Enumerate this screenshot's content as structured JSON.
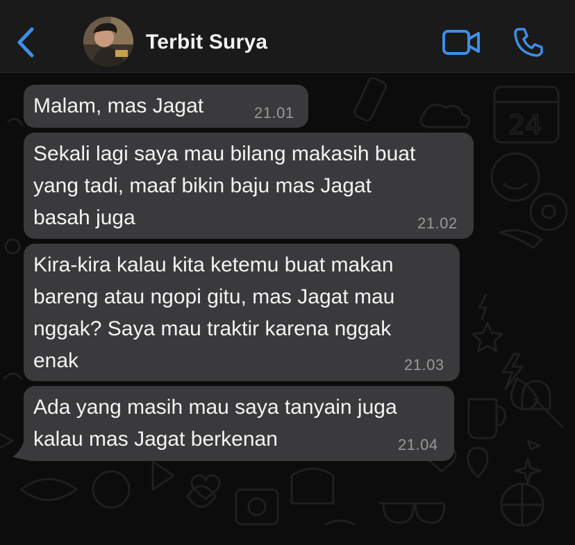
{
  "header": {
    "contact_name": "Terbit Surya",
    "back_icon": "chevron-left-icon",
    "video_icon": "video-camera-icon",
    "call_icon": "phone-icon",
    "accent_color": "#3e8fe8"
  },
  "messages": [
    {
      "text": "Malam, mas Jagat",
      "time": "21.01"
    },
    {
      "text": "Sekali lagi saya mau bilang makasih buat\nyang tadi, maaf bikin baju mas Jagat\nbasah juga",
      "time": "21.02"
    },
    {
      "text": "Kira-kira kalau kita ketemu buat makan\nbareng atau ngopi gitu, mas Jagat mau\nnggak? Saya mau traktir karena nggak\nenak",
      "time": "21.03"
    },
    {
      "text": "Ada yang masih mau saya tanyain juga\nkalau mas Jagat berkenan",
      "time": "21.04"
    }
  ],
  "colors": {
    "bubble": "#3a3a3c",
    "background": "#0c0c0c",
    "header": "#1a1a1a"
  }
}
